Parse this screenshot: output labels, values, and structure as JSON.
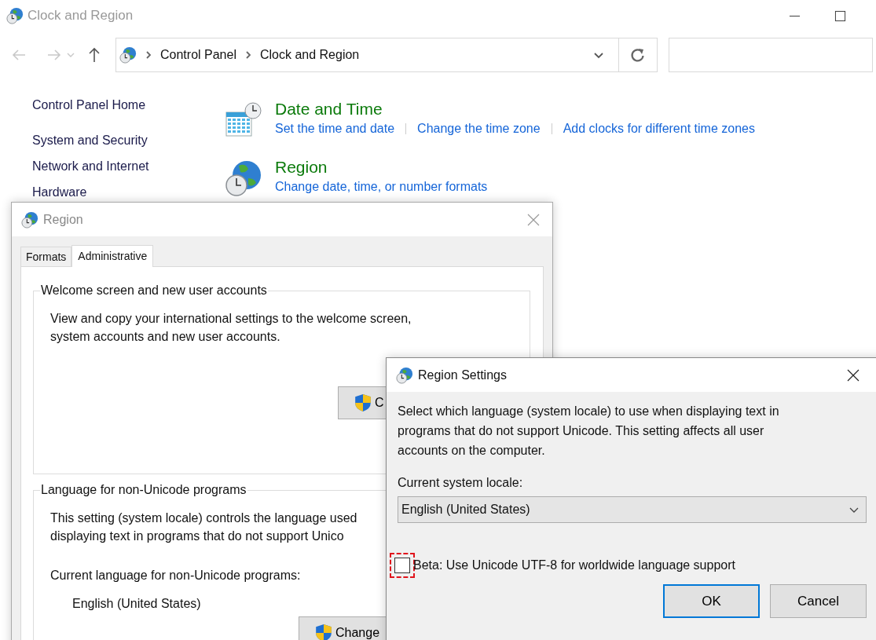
{
  "window": {
    "title": "Clock and Region"
  },
  "address_bar": {
    "crumbs": [
      "Control Panel",
      "Clock and Region"
    ]
  },
  "sidebar": {
    "items": [
      {
        "label": "Control Panel Home"
      },
      {
        "label": "System and Security"
      },
      {
        "label": "Network and Internet"
      },
      {
        "label": "Hardware"
      }
    ]
  },
  "categories": [
    {
      "title": "Date and Time",
      "kind": "datetime",
      "links": [
        "Set the time and date",
        "Change the time zone",
        "Add clocks for different time zones"
      ]
    },
    {
      "title": "Region",
      "kind": "region",
      "links": [
        "Change date, time, or number formats"
      ]
    }
  ],
  "region_dialog": {
    "title": "Region",
    "tabs": [
      {
        "label": "Formats",
        "selected": false
      },
      {
        "label": "Administrative",
        "selected": true
      }
    ],
    "groups": [
      {
        "title": "Welcome screen and new user accounts",
        "lines": [
          "View and copy your international settings to the welcome screen,",
          "system accounts and new user accounts."
        ],
        "button": "C"
      },
      {
        "title": "Language for non-Unicode programs",
        "lines": [
          "This setting (system locale) controls the language used",
          "displaying text in programs that do not support Unico"
        ],
        "current_label": "Current language for non-Unicode programs:",
        "current_value": "English (United States)",
        "button": "Change"
      }
    ]
  },
  "settings_dialog": {
    "title": "Region Settings",
    "description": "Select which language (system locale) to use when displaying text in programs that do not support Unicode. This setting affects all user accounts on the computer.",
    "locale_label": "Current system locale:",
    "locale_value": "English (United States)",
    "beta_checkbox": {
      "label": "Beta: Use Unicode UTF-8 for worldwide language support",
      "checked": false
    },
    "buttons": [
      {
        "label": "OK",
        "default": true
      },
      {
        "label": "Cancel",
        "default": false
      }
    ]
  }
}
